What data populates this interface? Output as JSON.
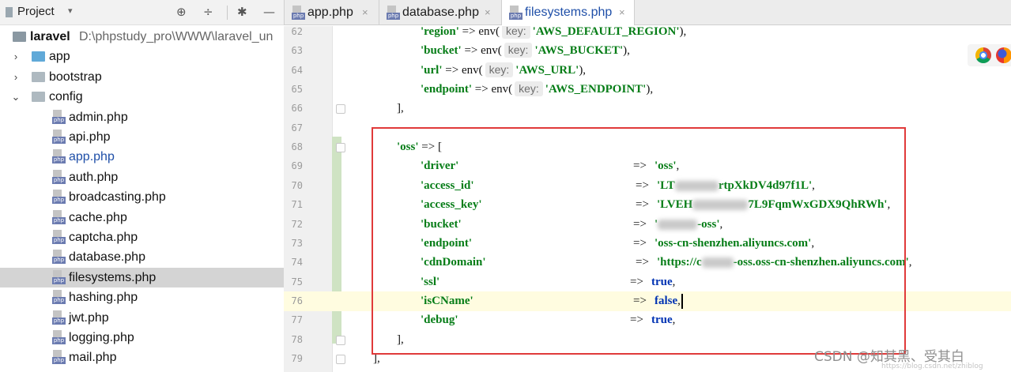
{
  "project_panel": {
    "title": "Project",
    "caret": "▾",
    "tools": {
      "target": "⊕",
      "collapse": "÷",
      "settings": "✱",
      "minimize": "—"
    },
    "tree": [
      {
        "name": "laravel",
        "path": "D:\\phpstudy_pro\\WWW\\laravel_un",
        "type": "root"
      },
      {
        "name": "app",
        "type": "folder",
        "expanded": false
      },
      {
        "name": "bootstrap",
        "type": "folder",
        "expanded": false
      },
      {
        "name": "config",
        "type": "folder",
        "expanded": true
      },
      {
        "name": "admin.php",
        "type": "file"
      },
      {
        "name": "api.php",
        "type": "file"
      },
      {
        "name": "app.php",
        "type": "file",
        "open": true
      },
      {
        "name": "auth.php",
        "type": "file"
      },
      {
        "name": "broadcasting.php",
        "type": "file"
      },
      {
        "name": "cache.php",
        "type": "file"
      },
      {
        "name": "captcha.php",
        "type": "file"
      },
      {
        "name": "database.php",
        "type": "file"
      },
      {
        "name": "filesystems.php",
        "type": "file",
        "selected": true
      },
      {
        "name": "hashing.php",
        "type": "file"
      },
      {
        "name": "jwt.php",
        "type": "file"
      },
      {
        "name": "logging.php",
        "type": "file"
      },
      {
        "name": "mail.php",
        "type": "file"
      }
    ]
  },
  "tabs": [
    {
      "label": "app.php",
      "close": "×"
    },
    {
      "label": "database.php",
      "close": "×"
    },
    {
      "label": "filesystems.php",
      "close": "×",
      "active": true
    }
  ],
  "editor": {
    "current_line": 76,
    "hint_label": "key:",
    "lines": [
      {
        "n": "62",
        "key": "'region'",
        "arrow": "=>",
        "fn": "env(",
        "arg": "'AWS_DEFAULT_REGION'",
        "end": "),",
        "hint": true
      },
      {
        "n": "63",
        "key": "'bucket'",
        "arrow": "=>",
        "fn": "env(",
        "arg": "'AWS_BUCKET'",
        "end": "),",
        "hint": true
      },
      {
        "n": "64",
        "key": "'url'",
        "arrow": "=>",
        "fn": "env(",
        "arg": "'AWS_URL'",
        "end": "),",
        "hint": true
      },
      {
        "n": "65",
        "key": "'endpoint'",
        "arrow": "=>",
        "fn": "env(",
        "arg": "'AWS_ENDPOINT'",
        "end": "),",
        "hint": true
      },
      {
        "n": "66",
        "text": "],"
      },
      {
        "n": "67",
        "text": ""
      },
      {
        "n": "68",
        "key": "'oss'",
        "arrow": "=>",
        "text_after": "["
      },
      {
        "n": "69",
        "key": "'driver'",
        "arrow": "=>",
        "value": "'oss'",
        "end": ","
      },
      {
        "n": "70",
        "key": "'access_id'",
        "arrow": "=>",
        "value_pre": "'LT",
        "value_post": "rtpXkDV4d97f1L'",
        "end": ","
      },
      {
        "n": "71",
        "key": "'access_key'",
        "arrow": "=>",
        "value_pre": "'LVEH",
        "value_post": "7L9FqmWxGDX9QhRWh'",
        "end": ","
      },
      {
        "n": "72",
        "key": "'bucket'",
        "arrow": "=>",
        "value_pre": "'",
        "value_post": "-oss'",
        "end": ","
      },
      {
        "n": "73",
        "key": "'endpoint'",
        "arrow": "=>",
        "value": "'oss-cn-shenzhen.aliyuncs.com'",
        "end": ","
      },
      {
        "n": "74",
        "key": "'cdnDomain'",
        "arrow": "=>",
        "value_pre": "'https://c",
        "value_post": "-oss.oss-cn-shenzhen.aliyuncs.com'",
        "end": ","
      },
      {
        "n": "75",
        "key": "'ssl'",
        "arrow": "=>",
        "bool": "true",
        "end": ","
      },
      {
        "n": "76",
        "key": "'isCName'",
        "arrow": "=>",
        "bool": "false",
        "end": ","
      },
      {
        "n": "77",
        "key": "'debug'",
        "arrow": "=>",
        "bool": "true",
        "end": ","
      },
      {
        "n": "78",
        "text": "],"
      },
      {
        "n": "79",
        "text": "],"
      }
    ]
  },
  "colors": {
    "highlight": "#e03a3a",
    "string": "#067d17",
    "keyword": "#0033b3",
    "selection": "#d4d4d4"
  },
  "watermark": {
    "text": "CSDN @知其黑、受其白",
    "url": "https://blog.csdn.net/zhiblog"
  }
}
